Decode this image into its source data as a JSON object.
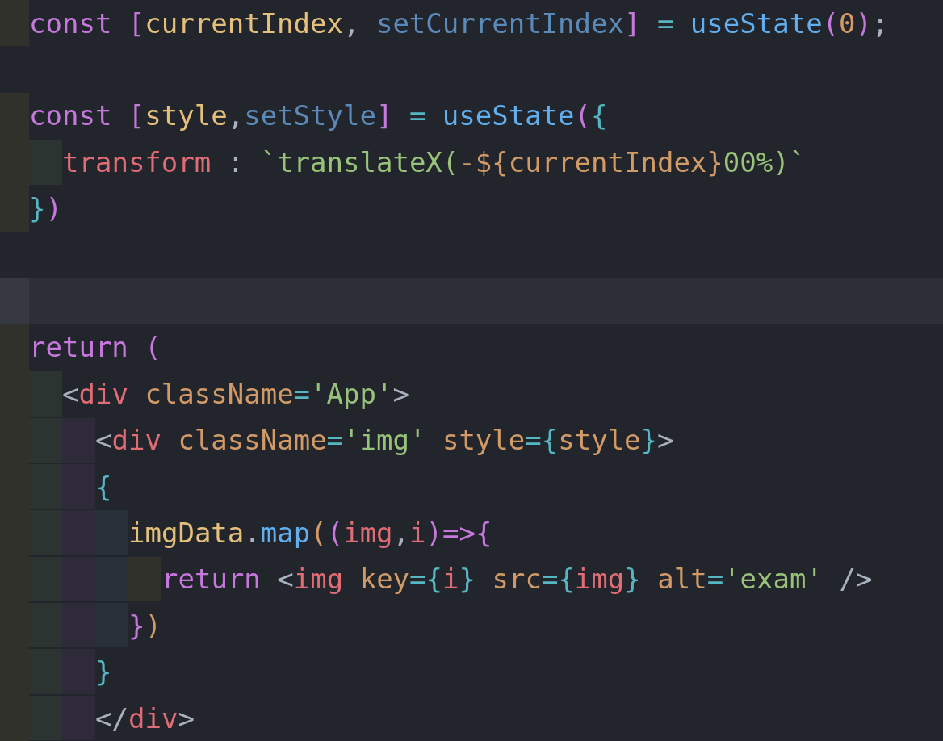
{
  "editor": {
    "lines": [
      {
        "current": false,
        "tokens": [
          {
            "text": "const ",
            "kind": "keyword"
          },
          {
            "text": "[",
            "kind": "bracket"
          },
          {
            "text": "currentIndex",
            "kind": "variable"
          },
          {
            "text": ", ",
            "kind": "punct"
          },
          {
            "text": "setCurrentIndex",
            "kind": "setter"
          },
          {
            "text": "]",
            "kind": "bracket"
          },
          {
            "text": " = ",
            "kind": "operator"
          },
          {
            "text": "useState",
            "kind": "function"
          },
          {
            "text": "(",
            "kind": "bracket"
          },
          {
            "text": "0",
            "kind": "number"
          },
          {
            "text": ")",
            "kind": "bracket"
          },
          {
            "text": ";",
            "kind": "punct"
          }
        ]
      },
      {
        "current": false
      },
      {
        "current": false,
        "tokens": [
          {
            "text": "const ",
            "kind": "keyword"
          },
          {
            "text": "[",
            "kind": "bracket"
          },
          {
            "text": "style",
            "kind": "variable"
          },
          {
            "text": ",",
            "kind": "punct"
          },
          {
            "text": "setStyle",
            "kind": "setter"
          },
          {
            "text": "]",
            "kind": "bracket"
          },
          {
            "text": " = ",
            "kind": "operator"
          },
          {
            "text": "useState",
            "kind": "function"
          },
          {
            "text": "(",
            "kind": "bracket"
          },
          {
            "text": "{",
            "kind": "operator"
          }
        ]
      },
      {
        "current": false,
        "indent_guides": [
          {
            "color": "#2b3431"
          }
        ],
        "tokens": [
          {
            "text": "transform",
            "kind": "property"
          },
          {
            "text": " : ",
            "kind": "punct"
          },
          {
            "text": "`translateX(",
            "kind": "string"
          },
          {
            "text": "-${currentIndex}",
            "kind": "number"
          },
          {
            "text": "00%)`",
            "kind": "string"
          }
        ]
      },
      {
        "current": false,
        "tokens": [
          {
            "text": "}",
            "kind": "operator"
          },
          {
            "text": ")",
            "kind": "bracket"
          }
        ]
      },
      {
        "current": false
      },
      {
        "current": true
      },
      {
        "current": false,
        "tokens": [
          {
            "text": "return ",
            "kind": "keyword"
          },
          {
            "text": "(",
            "kind": "bracket"
          }
        ]
      },
      {
        "current": false,
        "indent_guides": [
          {
            "color": "#2b3431"
          }
        ],
        "tokens": [
          {
            "text": "<",
            "kind": "punct"
          },
          {
            "text": "div",
            "kind": "tag"
          },
          {
            "text": " className",
            "kind": "number"
          },
          {
            "text": "=",
            "kind": "operator"
          },
          {
            "text": "'App'",
            "kind": "string"
          },
          {
            "text": ">",
            "kind": "punct"
          }
        ]
      },
      {
        "current": false,
        "indent_guides": [
          {
            "color": "#2b3431"
          },
          {
            "color": "#2e2a39"
          }
        ],
        "tokens": [
          {
            "text": "<",
            "kind": "punct"
          },
          {
            "text": "div",
            "kind": "tag"
          },
          {
            "text": " className",
            "kind": "number"
          },
          {
            "text": "=",
            "kind": "operator"
          },
          {
            "text": "'img'",
            "kind": "string"
          },
          {
            "text": " style",
            "kind": "number"
          },
          {
            "text": "={",
            "kind": "operator"
          },
          {
            "text": "style",
            "kind": "number"
          },
          {
            "text": "}",
            "kind": "operator"
          },
          {
            "text": ">",
            "kind": "punct"
          }
        ]
      },
      {
        "current": false,
        "indent_guides": [
          {
            "color": "#2b3431"
          },
          {
            "color": "#2e2a39"
          }
        ],
        "tokens": [
          {
            "text": "{",
            "kind": "operator"
          }
        ]
      },
      {
        "current": false,
        "indent_guides": [
          {
            "color": "#2b3431"
          },
          {
            "color": "#2e2a39"
          },
          {
            "color": "#28313a"
          }
        ],
        "tokens": [
          {
            "text": "imgData",
            "kind": "variable"
          },
          {
            "text": ".",
            "kind": "punct"
          },
          {
            "text": "map",
            "kind": "function"
          },
          {
            "text": "(",
            "kind": "number"
          },
          {
            "text": "(",
            "kind": "bracket"
          },
          {
            "text": "img",
            "kind": "tag"
          },
          {
            "text": ",",
            "kind": "punct"
          },
          {
            "text": "i",
            "kind": "tag"
          },
          {
            "text": ")=>{",
            "kind": "bracket"
          }
        ]
      },
      {
        "current": false,
        "indent_guides": [
          {
            "color": "#2b3431"
          },
          {
            "color": "#2e2a39"
          },
          {
            "color": "#28313a"
          },
          {
            "color": "#31312b"
          }
        ],
        "tokens": [
          {
            "text": "return ",
            "kind": "keyword"
          },
          {
            "text": "<",
            "kind": "punct"
          },
          {
            "text": "img",
            "kind": "tag"
          },
          {
            "text": " key",
            "kind": "number"
          },
          {
            "text": "={",
            "kind": "operator"
          },
          {
            "text": "i",
            "kind": "tag"
          },
          {
            "text": "}",
            "kind": "operator"
          },
          {
            "text": " src",
            "kind": "number"
          },
          {
            "text": "={",
            "kind": "operator"
          },
          {
            "text": "img",
            "kind": "tag"
          },
          {
            "text": "}",
            "kind": "operator"
          },
          {
            "text": " alt",
            "kind": "number"
          },
          {
            "text": "=",
            "kind": "operator"
          },
          {
            "text": "'exam'",
            "kind": "string"
          },
          {
            "text": " />",
            "kind": "punct"
          }
        ]
      },
      {
        "current": false,
        "indent_guides": [
          {
            "color": "#2b3431"
          },
          {
            "color": "#2e2a39"
          },
          {
            "color": "#28313a"
          }
        ],
        "tokens": [
          {
            "text": "}",
            "kind": "bracket"
          },
          {
            "text": ")",
            "kind": "number"
          }
        ]
      },
      {
        "current": false,
        "indent_guides": [
          {
            "color": "#2b3431"
          },
          {
            "color": "#2e2a39"
          }
        ],
        "tokens": [
          {
            "text": "}",
            "kind": "operator"
          }
        ]
      },
      {
        "current": false,
        "indent_guides": [
          {
            "color": "#2b3431"
          },
          {
            "color": "#2e2a39"
          }
        ],
        "tokens": [
          {
            "text": "</",
            "kind": "punct"
          },
          {
            "text": "div",
            "kind": "tag"
          },
          {
            "text": ">",
            "kind": "punct"
          }
        ]
      }
    ]
  }
}
